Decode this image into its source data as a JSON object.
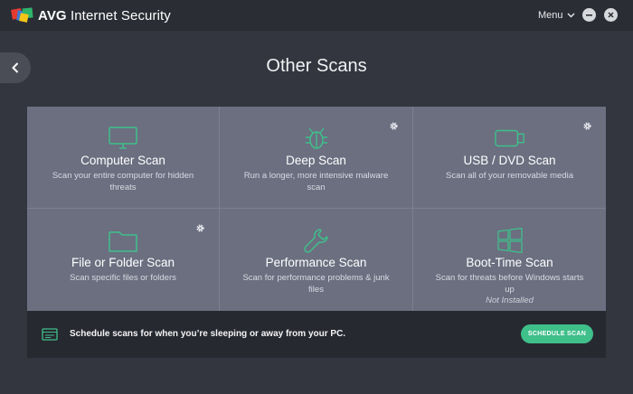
{
  "titlebar": {
    "brand_bold": "AVG",
    "brand_rest": " Internet Security",
    "menu_label": "Menu"
  },
  "page": {
    "title": "Other Scans"
  },
  "tiles": [
    {
      "name": "Computer Scan",
      "desc": "Scan your entire computer for hidden threats",
      "icon": "monitor-icon"
    },
    {
      "name": "Deep Scan",
      "desc": "Run a longer, more intensive malware scan",
      "icon": "bug-icon"
    },
    {
      "name": "USB / DVD Scan",
      "desc": "Scan all of your removable media",
      "icon": "usb-drive-icon"
    },
    {
      "name": "File or Folder Scan",
      "desc": "Scan specific files or folders",
      "icon": "folder-icon"
    },
    {
      "name": "Performance Scan",
      "desc": "Scan for performance problems & junk files",
      "icon": "wrench-icon"
    },
    {
      "name": "Boot-Time Scan",
      "desc": "Scan for threats before Windows starts up",
      "icon": "windows-icon",
      "status": "Not Installed"
    }
  ],
  "schedule": {
    "text": "Schedule scans for when you’re sleeping or away from your PC.",
    "button_label": "SCHEDULE SCAN"
  },
  "colors": {
    "accent": "#3fbf8a",
    "tile_bg": "#6b6f80",
    "body_bg": "#33363f"
  }
}
